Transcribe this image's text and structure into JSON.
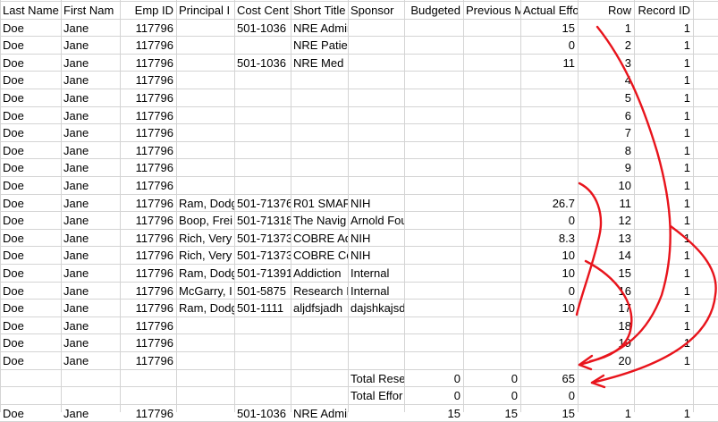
{
  "columns": [
    "Last Name",
    "First Name",
    "Emp ID",
    "Principal Investigator",
    "Cost Center",
    "Short Title",
    "Sponsor",
    "Budgeted",
    "Previous Month",
    "Actual Effort",
    "Row",
    "Record ID"
  ],
  "header_display": [
    "Last Name",
    "First Nam",
    "Emp ID",
    "Principal I",
    "Cost Cent",
    "Short Title",
    "Sponsor",
    "Budgeted",
    "Previous M",
    "Actual Effo",
    "Row",
    "Record ID"
  ],
  "rows": [
    [
      "Doe",
      "Jane",
      "117796",
      "",
      "501-1036",
      "NRE Admin",
      "",
      "",
      "",
      "15",
      "1",
      "1"
    ],
    [
      "Doe",
      "Jane",
      "117796",
      "",
      "",
      "NRE Patient Care",
      "",
      "",
      "",
      "0",
      "2",
      "1"
    ],
    [
      "Doe",
      "Jane",
      "117796",
      "",
      "501-1036",
      "NRE Med Ed",
      "",
      "",
      "",
      "11",
      "3",
      "1"
    ],
    [
      "Doe",
      "Jane",
      "117796",
      "",
      "",
      "",
      "",
      "",
      "",
      "",
      "4",
      "1"
    ],
    [
      "Doe",
      "Jane",
      "117796",
      "",
      "",
      "",
      "",
      "",
      "",
      "",
      "5",
      "1"
    ],
    [
      "Doe",
      "Jane",
      "117796",
      "",
      "",
      "",
      "",
      "",
      "",
      "",
      "6",
      "1"
    ],
    [
      "Doe",
      "Jane",
      "117796",
      "",
      "",
      "",
      "",
      "",
      "",
      "",
      "7",
      "1"
    ],
    [
      "Doe",
      "Jane",
      "117796",
      "",
      "",
      "",
      "",
      "",
      "",
      "",
      "8",
      "1"
    ],
    [
      "Doe",
      "Jane",
      "117796",
      "",
      "",
      "",
      "",
      "",
      "",
      "",
      "9",
      "1"
    ],
    [
      "Doe",
      "Jane",
      "117796",
      "",
      "",
      "",
      "",
      "",
      "",
      "",
      "10",
      "1"
    ],
    [
      "Doe",
      "Jane",
      "117796",
      "Ram, Dodg",
      "501-71376",
      "R01 SMAR",
      "NIH",
      "",
      "",
      "26.7",
      "11",
      "1"
    ],
    [
      "Doe",
      "Jane",
      "117796",
      "Boop, Frei",
      "501-71318",
      "The Navig",
      "Arnold Foundation",
      "",
      "",
      "0",
      "12",
      "1"
    ],
    [
      "Doe",
      "Jane",
      "117796",
      "Rich, Very",
      "501-71373",
      "COBRE Ad",
      "NIH",
      "",
      "",
      "8.3",
      "13",
      "1"
    ],
    [
      "Doe",
      "Jane",
      "117796",
      "Rich, Very",
      "501-71373",
      "COBRE Co",
      "NIH",
      "",
      "",
      "10",
      "14",
      "1"
    ],
    [
      "Doe",
      "Jane",
      "117796",
      "Ram, Dodg",
      "501-71391",
      "Addiction",
      "Internal",
      "",
      "",
      "10",
      "15",
      "1"
    ],
    [
      "Doe",
      "Jane",
      "117796",
      "McGarry, I",
      "501-5875",
      "Research I",
      "Internal",
      "",
      "",
      "0",
      "16",
      "1"
    ],
    [
      "Doe",
      "Jane",
      "117796",
      "Ram, Dodg",
      "501-1111",
      "aljdfsjadh",
      "dajshkajsdf",
      "",
      "",
      "10",
      "17",
      "1"
    ],
    [
      "Doe",
      "Jane",
      "117796",
      "",
      "",
      "",
      "",
      "",
      "",
      "",
      "18",
      "1"
    ],
    [
      "Doe",
      "Jane",
      "117796",
      "",
      "",
      "",
      "",
      "",
      "",
      "",
      "19",
      "1"
    ],
    [
      "Doe",
      "Jane",
      "117796",
      "",
      "",
      "",
      "",
      "",
      "",
      "",
      "20",
      "1"
    ]
  ],
  "totals": [
    {
      "label": "Total Rese",
      "budgeted": "0",
      "previous": "0",
      "actual": "65"
    },
    {
      "label": "Total Effor",
      "budgeted": "0",
      "previous": "0",
      "actual": "0"
    }
  ],
  "last_row": [
    "Doe",
    "Jane",
    "117796",
    "",
    "501-1036",
    "NRE Admin",
    "",
    "15",
    "15",
    "15",
    "1",
    "1"
  ],
  "annotation_color": "#e8141c"
}
